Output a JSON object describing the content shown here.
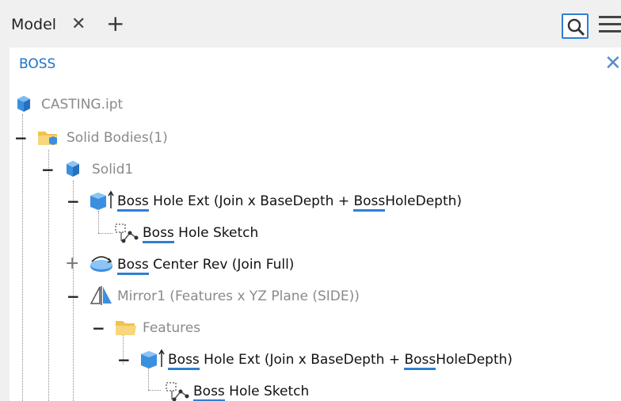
{
  "browser": {
    "tab_label": "Model",
    "filter_text": "BOSS"
  },
  "tree": {
    "root": {
      "label": "CASTING.ipt"
    },
    "solid_bodies": {
      "label": "Solid Bodies(1)"
    },
    "solid1": {
      "label": "Solid1"
    },
    "boss_hole_ext": {
      "match": "Boss",
      "label": " Hole Ext (Join x BaseDepth + ",
      "match2": "Boss",
      "suffix": "HoleDepth)"
    },
    "boss_hole_sketch": {
      "match": "Boss",
      "label": " Hole Sketch"
    },
    "boss_center_rev": {
      "match": "Boss",
      "label": " Center Rev (Join Full)"
    },
    "mirror1": {
      "label": "Mirror1 (Features x YZ Plane (SIDE))"
    },
    "features": {
      "label": "Features"
    },
    "boss_hole_ext_2": {
      "match": "Boss",
      "label": " Hole Ext (Join x BaseDepth + ",
      "match2": "Boss",
      "suffix": "HoleDepth)"
    },
    "boss_hole_sketch_2": {
      "match": "Boss",
      "label": " Hole Sketch"
    }
  },
  "colors": {
    "accent": "#2f7fd1",
    "part_blue": "#3b8fe0",
    "folder_yellow": "#f2c14e"
  },
  "icons": [
    "close-icon",
    "plus-icon",
    "search-icon",
    "menu-icon",
    "part-icon",
    "folder-icon",
    "solid-body-icon",
    "extrude-icon",
    "sketch-icon",
    "revolve-icon",
    "mirror-icon"
  ]
}
